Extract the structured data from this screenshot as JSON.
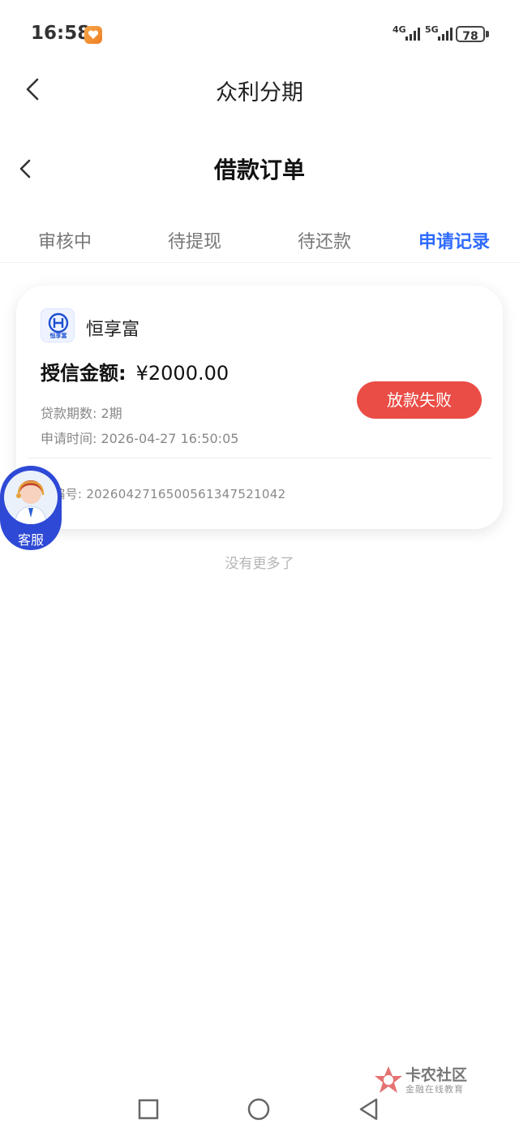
{
  "status_bar": {
    "time": "16:58",
    "signal1_label": "4G",
    "signal2_label": "5G",
    "battery": "78"
  },
  "header": {
    "app_title": "众利分期",
    "page_title": "借款订单"
  },
  "tabs": [
    {
      "label": "审核中",
      "active": false
    },
    {
      "label": "待提现",
      "active": false
    },
    {
      "label": "待还款",
      "active": false
    },
    {
      "label": "申请记录",
      "active": true
    }
  ],
  "order": {
    "brand_name": "恒享富",
    "brand_logo_text": "恒享富",
    "amount_label": "授信金额:",
    "amount_value": "¥2000.00",
    "periods_label": "贷款期数:",
    "periods_value": "2期",
    "apply_time_label": "申请时间:",
    "apply_time_value": "2026-04-27 16:50:05",
    "status_button": "放款失败",
    "order_no_label": "单编号:",
    "order_no_value": "20260427165005613475210​42"
  },
  "list_end_text": "没有更多了",
  "customer_service": {
    "label": "客服"
  },
  "watermark": {
    "title": "卡农社区",
    "subtitle": "金融在线教育"
  },
  "colors": {
    "accent": "#2f6bff",
    "status_fail": "#ea4c46",
    "cs_bg": "#2e49d6"
  }
}
